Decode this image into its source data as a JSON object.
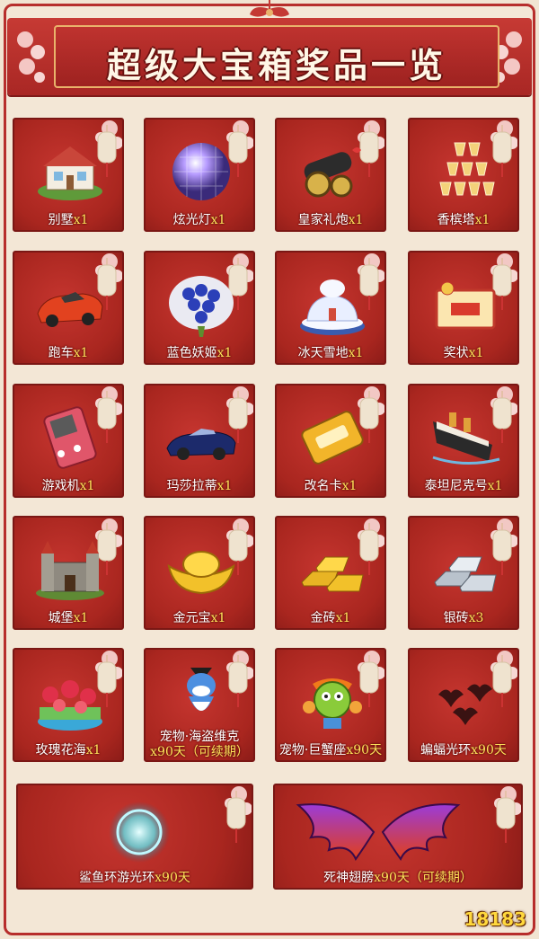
{
  "title": "超级大宝箱奖品一览",
  "colors": {
    "card_red": "#b22a24",
    "qty_yellow": "#ffe35a",
    "frame_red": "#b72e2c",
    "gold": "#e9b36b"
  },
  "items": [
    {
      "name": "别墅",
      "qty": "x1",
      "icon": "villa-icon"
    },
    {
      "name": "炫光灯",
      "qty": "x1",
      "icon": "disco-ball-icon"
    },
    {
      "name": "皇家礼炮",
      "qty": "x1",
      "icon": "cannon-icon"
    },
    {
      "name": "香槟塔",
      "qty": "x1",
      "icon": "champagne-tower-icon"
    },
    {
      "name": "跑车",
      "qty": "x1",
      "icon": "sports-car-icon"
    },
    {
      "name": "蓝色妖姬",
      "qty": "x1",
      "icon": "blue-rose-bouquet-icon"
    },
    {
      "name": "冰天雪地",
      "qty": "x1",
      "icon": "snow-land-icon"
    },
    {
      "name": "奖状",
      "qty": "x1",
      "icon": "certificate-icon"
    },
    {
      "name": "游戏机",
      "qty": "x1",
      "icon": "game-console-icon"
    },
    {
      "name": "玛莎拉蒂",
      "qty": "x1",
      "icon": "maserati-icon"
    },
    {
      "name": "改名卡",
      "qty": "x1",
      "icon": "rename-card-icon"
    },
    {
      "name": "泰坦尼克号",
      "qty": "x1",
      "icon": "titanic-icon"
    },
    {
      "name": "城堡",
      "qty": "x1",
      "icon": "castle-icon"
    },
    {
      "name": "金元宝",
      "qty": "x1",
      "icon": "gold-ingot-icon"
    },
    {
      "name": "金砖",
      "qty": "x1",
      "icon": "gold-bar-icon"
    },
    {
      "name": "银砖",
      "qty": "x3",
      "icon": "silver-bar-icon"
    },
    {
      "name": "玫瑰花海",
      "qty": "x1",
      "icon": "rose-sea-icon"
    },
    {
      "name": "宠物·海盗维克",
      "qty": "x90天（可续期）",
      "icon": "pirate-shark-icon"
    },
    {
      "name": "宠物·巨蟹座",
      "qty": "x90天",
      "icon": "cancer-pet-icon"
    },
    {
      "name": "蝙蝠光环",
      "qty": "x90天",
      "icon": "bat-halo-icon"
    },
    {
      "name": "鲨鱼环游光环",
      "qty": "x90天",
      "icon": "shark-halo-icon"
    },
    {
      "name": "死神翅膀",
      "qty": "x90天（可续期）",
      "icon": "death-wings-icon"
    }
  ],
  "watermark": "18183"
}
